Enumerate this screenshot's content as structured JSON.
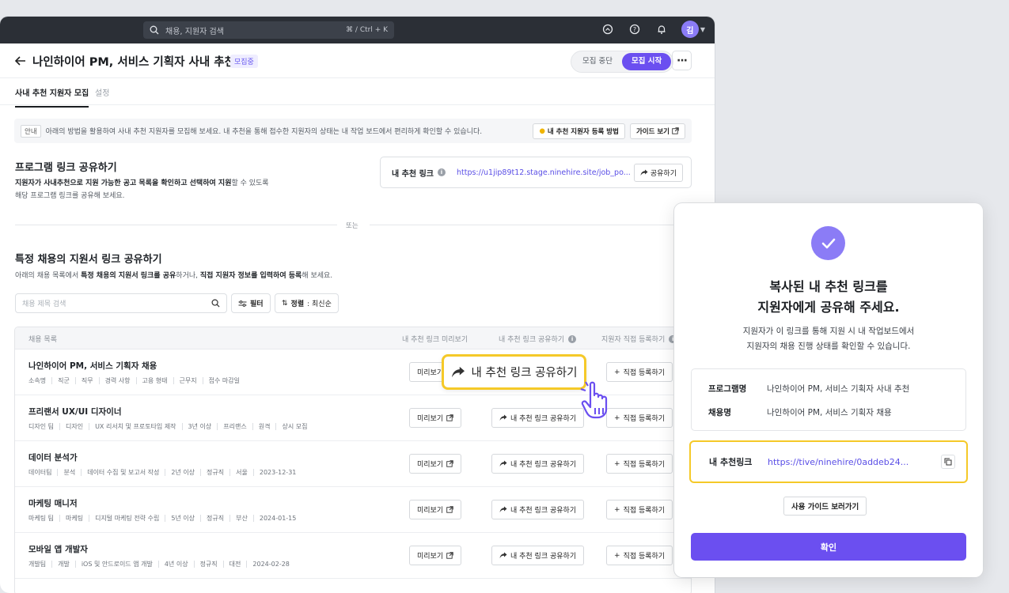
{
  "topbar": {
    "search_placeholder": "채용, 지원자 검색",
    "shortcut": "⌘ / Ctrl + K",
    "avatar_initial": "김"
  },
  "header": {
    "title": "나인하이어 PM, 서비스 기획자 사내 추천",
    "status": "모집중",
    "stop_label": "모집 중단",
    "start_label": "모집 시작"
  },
  "tabs": [
    {
      "label": "사내 추천 지원자 모집"
    },
    {
      "label": "설정"
    }
  ],
  "notice": {
    "tag": "안내",
    "text": "아래의 방법을 활용하여 사내 추천 지원자를 모집해 보세요. 내 추천을 통해 접수한 지원자의 상태는 내 작업 보드에서 편리하게 확인할 수 있습니다.",
    "howto_label": "내 추천 지원자 등록 방법",
    "guide_label": "가이드 보기"
  },
  "program_link": {
    "title": "프로그램 링크 공유하기",
    "desc_bold": "지원자가 사내추천으로 지원 가능한 공고 목록을 확인하고 선택하여 지원",
    "desc_rest1": "할 수 있도록",
    "desc_line2": "해당 프로그램 링크를 공유해 보세요.",
    "link_label": "내 추천 링크",
    "link_url": "https://u1jip89t12.stage.ninehire.site/job_po...",
    "share_label": "공유하기"
  },
  "or_label": "또는",
  "specific": {
    "title": "특정 채용의 지원서 링크 공유하기",
    "desc_a": "아래의 채용 목록에서 ",
    "desc_b": "특정 채용의 지원서 링크를 공유",
    "desc_c": "하거나, ",
    "desc_d": "직접 지원자 정보를 입력하여 등록",
    "desc_e": "해 보세요.",
    "search_placeholder": "채용 제목 검색",
    "filter_label": "필터",
    "sort_label": "정렬",
    "sort_value": ": 최신순"
  },
  "table": {
    "headers": {
      "list": "채용 목록",
      "preview": "내 추천 링크 미리보기",
      "share": "내 추천 링크 공유하기",
      "register": "지원자 직접 등록하기"
    },
    "preview_label": "미리보기",
    "share_label": "내 추천 링크 공유하기",
    "register_label": "직접 등록하기",
    "rows": [
      {
        "title": "나인하이어 PM, 서비스 기획자 채용",
        "meta": [
          "소속명",
          "직군",
          "직무",
          "경력 사항",
          "고용 형태",
          "근무지",
          "접수 마감일"
        ]
      },
      {
        "title": "프리랜서 UX/UI 디자이너",
        "meta": [
          "디자인 팀",
          "디자인",
          "UX 리서치 및 프로토타입 제작",
          "3년 이상",
          "프리랜스",
          "원격",
          "상시 모집"
        ]
      },
      {
        "title": "데이터 분석가",
        "meta": [
          "데이터팀",
          "분석",
          "데이터 수집 및 보고서 작성",
          "2년 이상",
          "정규직",
          "서울",
          "2023-12-31"
        ]
      },
      {
        "title": "마케팅 매니저",
        "meta": [
          "마케팅 팀",
          "마케팅",
          "디지털 마케팅 전략 수립",
          "5년 이상",
          "정규직",
          "부산",
          "2024-01-15"
        ]
      },
      {
        "title": "모바일 앱 개발자",
        "meta": [
          "개발팀",
          "개발",
          "iOS 및 안드로이드 앱 개발",
          "4년 이상",
          "정규직",
          "대전",
          "2024-02-28"
        ]
      }
    ]
  },
  "highlight": {
    "label": "내 추천 링크 공유하기"
  },
  "modal": {
    "title_line1": "복사된 내 추천 링크를",
    "title_line2": "지원자에게 공유해 주세요.",
    "desc_line1": "지원자가 이 링크를 통해 지원 시 내 작업보드에서",
    "desc_line2": "지원자의 채용 진행 상태를 확인할 수 있습니다.",
    "program_key": "프로그램명",
    "program_value": "나인하이어 PM, 서비스 기획자 사내 추천",
    "job_key": "채용명",
    "job_value": "나인하이어 PM, 서비스 기획자 채용",
    "link_key": "내 추천링크",
    "link_value": "https://tive/ninehire/0addeb24...",
    "guide_label": "사용 가이드 보러가기",
    "confirm_label": "확인"
  },
  "colors": {
    "accent": "#6b4ff0",
    "highlight": "#f5c928",
    "topbar": "#2b2f36"
  }
}
